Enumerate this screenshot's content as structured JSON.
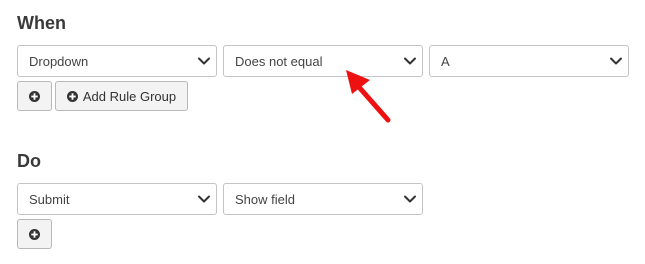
{
  "when": {
    "title": "When",
    "field_select": "Dropdown",
    "operator_select": "Does not equal",
    "value_select": "A",
    "add_rule_group_label": "Add Rule Group"
  },
  "do": {
    "title": "Do",
    "target_select": "Submit",
    "action_select": "Show field"
  },
  "icons": {
    "plus": "plus-circle-icon",
    "chevron": "chevron-down-icon",
    "arrow": "red-arrow-annotation"
  },
  "colors": {
    "arrow": "#ee1111"
  }
}
